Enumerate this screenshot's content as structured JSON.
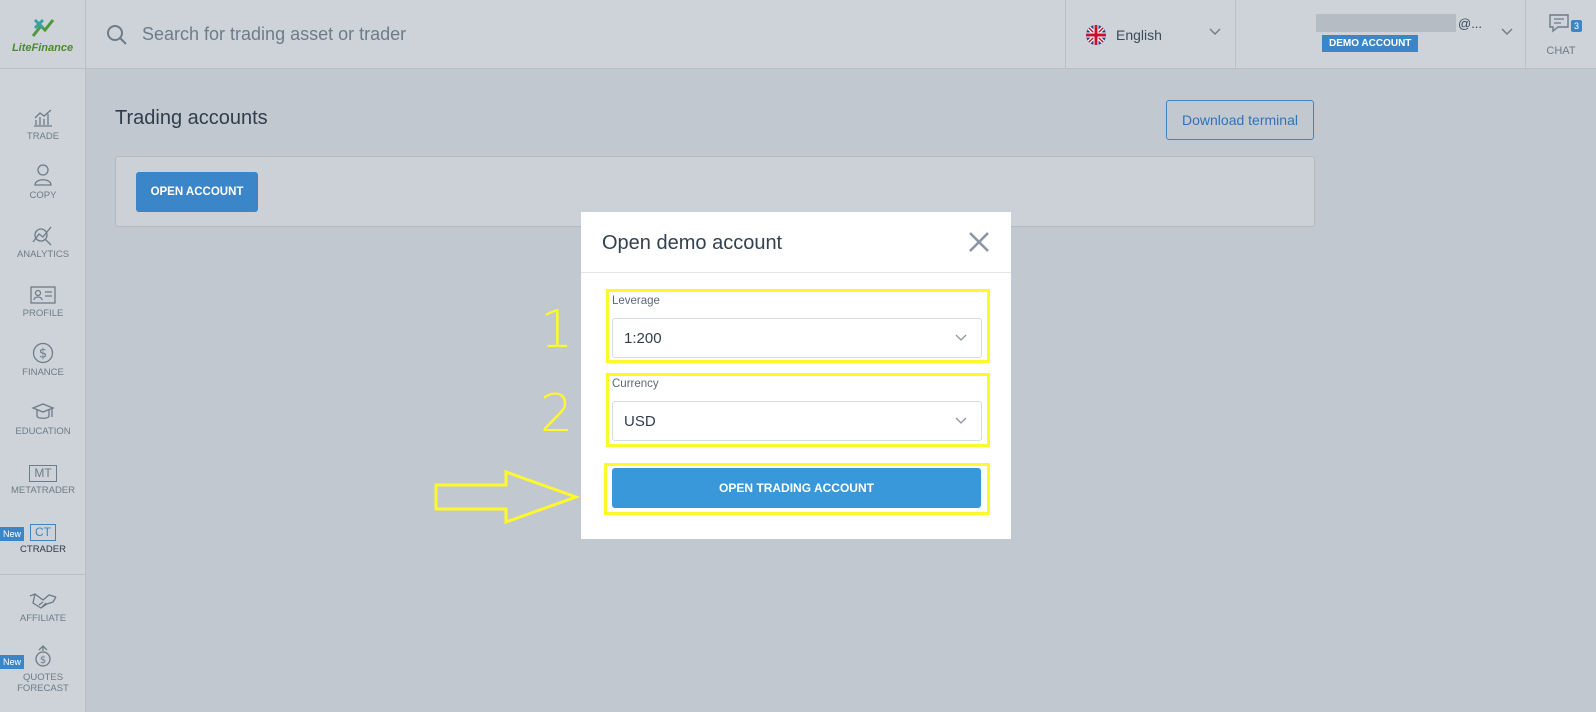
{
  "brand": {
    "name": "LiteFinance"
  },
  "search": {
    "placeholder": "Search for trading asset or trader"
  },
  "language": {
    "label": "English",
    "icon": "uk-flag-icon"
  },
  "account": {
    "email_suffix": "@...",
    "badge": "DEMO ACCOUNT"
  },
  "chat": {
    "label": "CHAT",
    "count": "3"
  },
  "sidebar": {
    "items": [
      {
        "label": "TRADE",
        "icon": "chart-icon"
      },
      {
        "label": "COPY",
        "icon": "trader-icon"
      },
      {
        "label": "ANALYTICS",
        "icon": "analytics-icon"
      },
      {
        "label": "PROFILE",
        "icon": "id-card-icon"
      },
      {
        "label": "FINANCE",
        "icon": "dollar-icon"
      },
      {
        "label": "EDUCATION",
        "icon": "graduation-cap-icon"
      },
      {
        "label": "METATRADER",
        "icon_text": "MT"
      },
      {
        "label": "CTRADER",
        "icon_text": "CT",
        "badge": "New"
      },
      {
        "label": "AFFILIATE",
        "icon": "handshake-icon"
      },
      {
        "label": "QUOTES FORECAST",
        "icon": "forecast-icon",
        "badge": "New"
      }
    ]
  },
  "main": {
    "title": "Trading accounts",
    "download_label": "Download terminal",
    "open_account_label": "OPEN ACCOUNT"
  },
  "modal": {
    "title": "Open demo account",
    "leverage_label": "Leverage",
    "leverage_value": "1:200",
    "currency_label": "Currency",
    "currency_value": "USD",
    "submit_label": "OPEN TRADING ACCOUNT"
  },
  "annotations": {
    "step1": "1",
    "step2": "2",
    "highlight_color": "#fff82a"
  }
}
